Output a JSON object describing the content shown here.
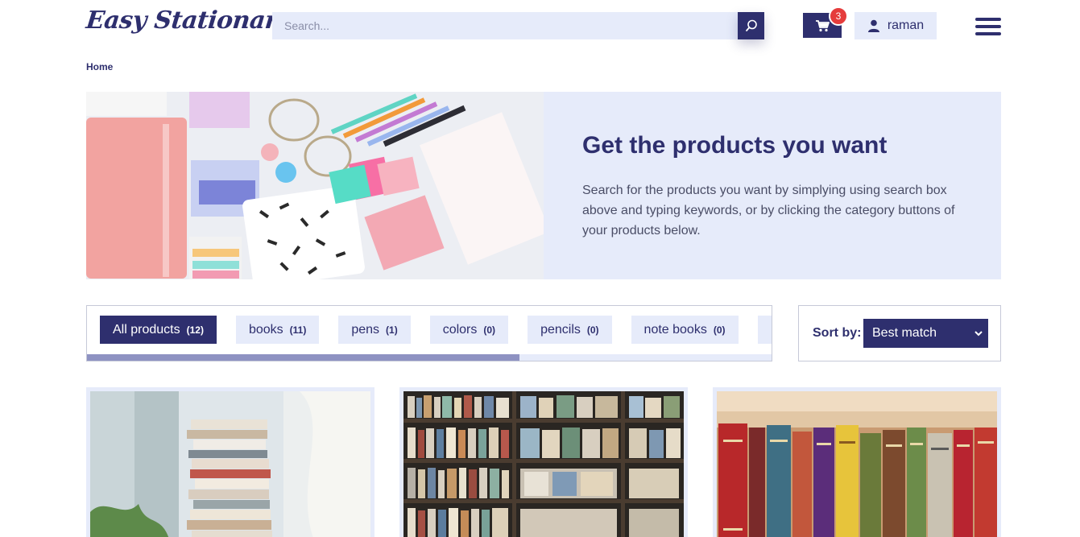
{
  "header": {
    "logo": "Easy Stationary",
    "search_placeholder": "Search...",
    "cart_count": "3",
    "user_name": "raman",
    "icons": [
      "search-icon",
      "cart-icon",
      "user-icon",
      "hamburger-menu-icon"
    ]
  },
  "breadcrumb": {
    "home": "Home"
  },
  "hero": {
    "title": "Get the products you want",
    "text": "Search for the products you want by simplying using search box above and typing keywords, or by clicking the category buttons of your products below."
  },
  "categories": [
    {
      "label": "All products",
      "count": "(12)",
      "active": true
    },
    {
      "label": "books",
      "count": "(11)",
      "active": false
    },
    {
      "label": "pens",
      "count": "(1)",
      "active": false
    },
    {
      "label": "colors",
      "count": "(0)",
      "active": false
    },
    {
      "label": "pencils",
      "count": "(0)",
      "active": false
    },
    {
      "label": "note books",
      "count": "(0)",
      "active": false
    }
  ],
  "category_scroll_position": 0.63,
  "sort": {
    "label": "Sort by:",
    "selected": "Best match"
  },
  "products": [
    {
      "image": "stacked-books-by-window-photo"
    },
    {
      "image": "bookstore-shelves-photo"
    },
    {
      "image": "colorful-book-spines-photo"
    }
  ],
  "colors": {
    "primary": "#2e2f6e",
    "light": "#e6ebfa",
    "badge": "#e53c3c",
    "scroll_thumb": "#8e92c2"
  }
}
